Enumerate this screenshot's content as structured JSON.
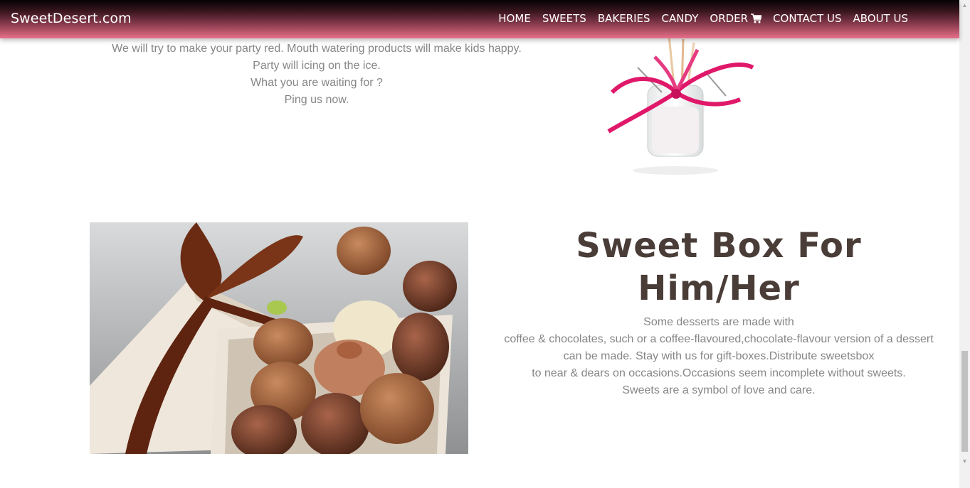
{
  "navbar": {
    "brand": "SweetDesert.com",
    "items": [
      {
        "label": "HOME"
      },
      {
        "label": "SWEETS"
      },
      {
        "label": "BAKERIES"
      },
      {
        "label": "CANDY"
      },
      {
        "label": "ORDER",
        "icon": "cart-icon"
      },
      {
        "label": "CONTACT US"
      },
      {
        "label": "ABOUT US"
      }
    ]
  },
  "party_section": {
    "lines": [
      "We will try to make your party red. Mouth watering products will make kids happy.",
      "Party will icing on the ice.",
      "What you are waiting for ?",
      "Ping us now."
    ]
  },
  "sweet_box_section": {
    "title": "Sweet Box For Him/Her",
    "lines": [
      "Some desserts are made with",
      "coffee & chocolates, such or a coffee-flavoured,chocolate-flavour version of a dessert",
      "can be made. Stay with us for gift-boxes.Distribute sweetsbox",
      "to near & dears on occasions.Occasions seem incomplete without sweets.",
      "Sweets are a symbol of love and care."
    ]
  },
  "colors": {
    "navbar_top": "#060304",
    "navbar_bottom": "#e8708a",
    "title_text": "#4a3d38",
    "body_text": "#868686",
    "ribbon_pink": "#e0186a",
    "ribbon_brown": "#6b2a12"
  }
}
